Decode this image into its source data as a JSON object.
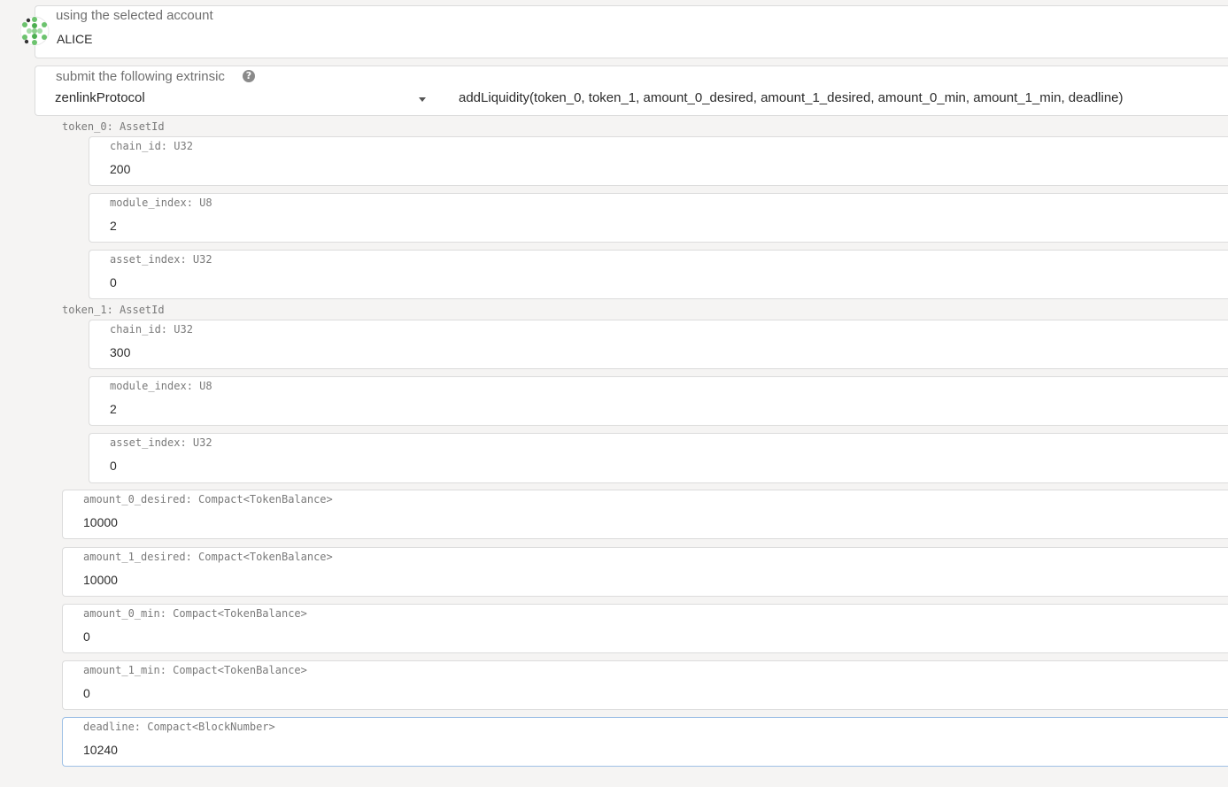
{
  "account": {
    "label": "using the selected account",
    "name": "ALICE",
    "avatar_icon": "identicon-icon"
  },
  "extrinsic": {
    "label": "submit the following extrinsic",
    "help_icon": "question-circle-icon",
    "module": "zenlinkProtocol",
    "method": "addLiquidity(token_0, token_1, amount_0_desired, amount_1_desired, amount_0_min, amount_1_min, deadline)"
  },
  "token_0": {
    "label": "token_0: AssetId",
    "chain_id": {
      "label": "chain_id: U32",
      "value": "200"
    },
    "module_index": {
      "label": "module_index: U8",
      "value": "2"
    },
    "asset_index": {
      "label": "asset_index: U32",
      "value": "0"
    }
  },
  "token_1": {
    "label": "token_1: AssetId",
    "chain_id": {
      "label": "chain_id: U32",
      "value": "300"
    },
    "module_index": {
      "label": "module_index: U8",
      "value": "2"
    },
    "asset_index": {
      "label": "asset_index: U32",
      "value": "0"
    }
  },
  "amount_0_desired": {
    "label": "amount_0_desired: Compact<TokenBalance>",
    "value": "10000"
  },
  "amount_1_desired": {
    "label": "amount_1_desired: Compact<TokenBalance>",
    "value": "10000"
  },
  "amount_0_min": {
    "label": "amount_0_min: Compact<TokenBalance>",
    "value": "0"
  },
  "amount_1_min": {
    "label": "amount_1_min: Compact<TokenBalance>",
    "value": "0"
  },
  "deadline": {
    "label": "deadline: Compact<BlockNumber>",
    "value": "10240"
  }
}
